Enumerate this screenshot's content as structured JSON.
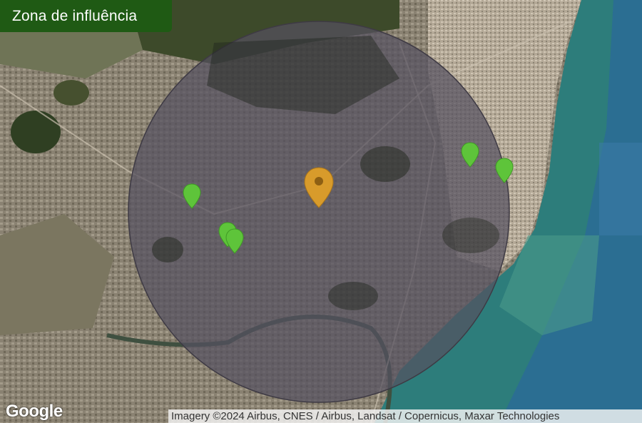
{
  "title": "Zona de influência",
  "google_logo": "Google",
  "attribution": "Imagery ©2024 Airbus, CNES / Airbus, Landsat / Copernicus, Maxar Technologies",
  "colors": {
    "badge_bg": "#1f5a14",
    "center_marker": "#d89b2b",
    "competitor_marker": "#5ec43a",
    "radius_overlay": "#555060"
  },
  "markers": [
    {
      "name": "center-location-marker",
      "type": "center",
      "icon": "map-pin-icon"
    },
    {
      "name": "location-marker-1",
      "type": "point",
      "icon": "map-pin-icon"
    },
    {
      "name": "location-marker-2",
      "type": "point",
      "icon": "map-pin-icon"
    },
    {
      "name": "location-marker-3",
      "type": "point",
      "icon": "map-pin-icon"
    },
    {
      "name": "location-marker-4",
      "type": "point",
      "icon": "map-pin-icon"
    },
    {
      "name": "location-marker-5",
      "type": "point",
      "icon": "map-pin-icon"
    }
  ]
}
